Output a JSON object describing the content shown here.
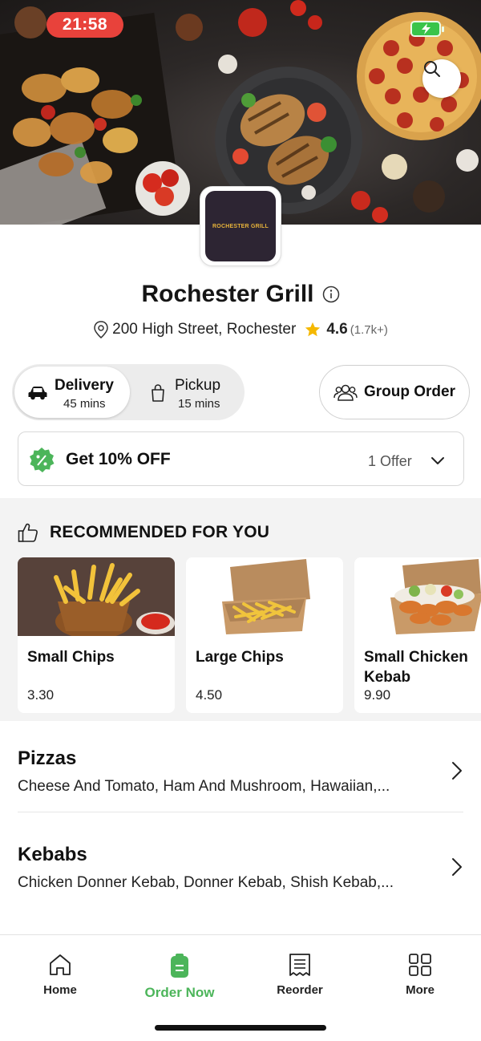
{
  "status_bar": {
    "time": "21:58"
  },
  "restaurant": {
    "logo_text": "ROCHESTER GRILL",
    "name": "Rochester Grill",
    "address": "200 High Street, Rochester",
    "rating": "4.6",
    "rating_count": "(1.7k+)"
  },
  "order_mode": {
    "delivery_label": "Delivery",
    "delivery_time": "45 mins",
    "pickup_label": "Pickup",
    "pickup_time": "15 mins",
    "selected": "Delivery"
  },
  "group_order_label": "Group Order",
  "offer": {
    "label": "Get 10% OFF",
    "count": "1 Offer"
  },
  "recommended": {
    "heading": "RECOMMENDED FOR YOU",
    "items": [
      {
        "name": "Small Chips",
        "price": "3.30"
      },
      {
        "name": "Large Chips",
        "price": "4.50"
      },
      {
        "name": "Small Chicken Kebab",
        "price": "9.90"
      }
    ]
  },
  "categories": [
    {
      "title": "Pizzas",
      "description": "Cheese And Tomato, Ham And Mushroom, Hawaiian,..."
    },
    {
      "title": "Kebabs",
      "description": "Chicken Donner Kebab, Donner Kebab, Shish Kebab,..."
    }
  ],
  "bottom_nav": [
    {
      "label": "Home",
      "icon": "home-icon"
    },
    {
      "label": "Order Now",
      "icon": "order-icon",
      "active": true
    },
    {
      "label": "Reorder",
      "icon": "receipt-icon"
    },
    {
      "label": "More",
      "icon": "grid-icon"
    }
  ],
  "colors": {
    "accent": "#4cb55a",
    "star": "#f5b800",
    "time_pill": "#e8423b",
    "offer_badge": "#4cb55a"
  }
}
